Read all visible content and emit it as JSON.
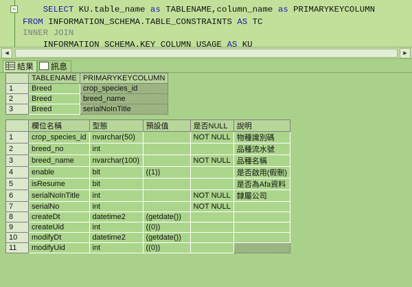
{
  "editor": {
    "fold_symbol": "−",
    "lines": [
      {
        "segments": [
          {
            "t": "    SELECT ",
            "c": "kw"
          },
          {
            "t": "KU.table_name ",
            "c": ""
          },
          {
            "t": "as ",
            "c": "kw"
          },
          {
            "t": "TABLENAME,column_name ",
            "c": ""
          },
          {
            "t": "as ",
            "c": "kw"
          },
          {
            "t": "PRIMARYKEYCOLUMN",
            "c": ""
          }
        ]
      },
      {
        "segments": [
          {
            "t": "FROM ",
            "c": "kw"
          },
          {
            "t": "INFORMATION_SCHEMA.TABLE_CONSTRAINTS ",
            "c": ""
          },
          {
            "t": "AS ",
            "c": "kw"
          },
          {
            "t": "TC",
            "c": ""
          }
        ]
      },
      {
        "segments": [
          {
            "t": "INNER JOIN",
            "c": "gray"
          }
        ]
      },
      {
        "segments": [
          {
            "t": "    INFORMATION_SCHEMA.KEY_COLUMN_USAGE ",
            "c": ""
          },
          {
            "t": "AS ",
            "c": "kw"
          },
          {
            "t": "KU",
            "c": ""
          }
        ]
      }
    ]
  },
  "scrollbar": {
    "left_arrow": "◄",
    "right_arrow": "►"
  },
  "tabs": [
    {
      "label": "結果",
      "icon": "results-grid-icon",
      "active": true
    },
    {
      "label": "訊息",
      "icon": "messages-icon",
      "active": false
    }
  ],
  "result1": {
    "headers": [
      "TABLENAME",
      "PRIMARYKEYCOLUMN"
    ],
    "rows": [
      [
        "1",
        "Breed",
        "crop_species_id"
      ],
      [
        "2",
        "Breed",
        "breed_name"
      ],
      [
        "3",
        "Breed",
        "serialNoInTitle"
      ]
    ]
  },
  "result2": {
    "headers": [
      "欄位名稱",
      "型態",
      "預設值",
      "是否NULL",
      "說明"
    ],
    "rows": [
      [
        "1",
        "crop_species_id",
        "nvarchar(50)",
        "",
        "NOT NULL",
        "物種識別碼"
      ],
      [
        "2",
        "breed_no",
        "int",
        "",
        "",
        "品種流水號"
      ],
      [
        "3",
        "breed_name",
        "nvarchar(100)",
        "",
        "NOT NULL",
        "品種名稱"
      ],
      [
        "4",
        "enable",
        "bit",
        "((1))",
        "",
        "是否啟用(假刪)"
      ],
      [
        "5",
        "isResume",
        "bit",
        "",
        "",
        "是否為Afa資料"
      ],
      [
        "6",
        "serialNoInTitle",
        "int",
        "",
        "NOT NULL",
        "隸屬公司"
      ],
      [
        "7",
        "serialNo",
        "int",
        "",
        "NOT NULL",
        ""
      ],
      [
        "8",
        "createDt",
        "datetime2",
        "(getdate())",
        "",
        ""
      ],
      [
        "9",
        "createUid",
        "int",
        "((0))",
        "",
        ""
      ],
      [
        "10",
        "modifyDt",
        "datetime2",
        "(getdate())",
        "",
        ""
      ],
      [
        "11",
        "modifyUid",
        "int",
        "((0))",
        "",
        ""
      ]
    ]
  }
}
